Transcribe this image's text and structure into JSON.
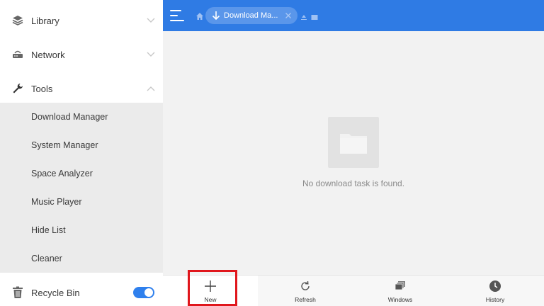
{
  "sidebar": {
    "sections": [
      {
        "label": "Library",
        "icon": "layers-icon",
        "expanded": false
      },
      {
        "label": "Network",
        "icon": "router-icon",
        "expanded": false
      },
      {
        "label": "Tools",
        "icon": "wrench-icon",
        "expanded": true
      }
    ],
    "tools_items": [
      {
        "label": "Download Manager"
      },
      {
        "label": "System Manager"
      },
      {
        "label": "Space Analyzer"
      },
      {
        "label": "Music Player"
      },
      {
        "label": "Hide List"
      },
      {
        "label": "Cleaner"
      }
    ],
    "recycle_bin": {
      "label": "Recycle Bin",
      "icon": "trash-icon",
      "toggle_on": true
    }
  },
  "topbar": {
    "menu_icon": "menu-icon",
    "home_icon": "home-icon",
    "breadcrumb_chip": "Download Ma...",
    "accent": "#2f7be4"
  },
  "main": {
    "empty_icon": "folder-icon",
    "empty_message": "No download task is found."
  },
  "toolbar": {
    "buttons": [
      {
        "label": "New",
        "icon": "plus-icon",
        "highlighted": true
      },
      {
        "label": "Refresh",
        "icon": "refresh-icon"
      },
      {
        "label": "Windows",
        "icon": "windows-icon"
      },
      {
        "label": "History",
        "icon": "clock-icon"
      }
    ],
    "highlight_color": "#e0161c"
  }
}
